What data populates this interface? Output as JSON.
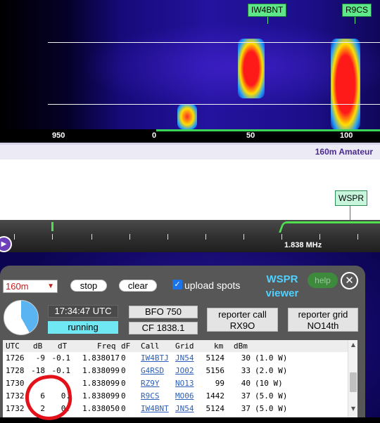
{
  "waterfall": {
    "callouts": [
      "IW4BNT",
      "R9CS"
    ],
    "scale_labels": [
      "950",
      "0",
      "50",
      "100"
    ]
  },
  "band_bar": {
    "label": "160m Amateur"
  },
  "spectrum": {
    "wspr_tag": "WSPR"
  },
  "dial": {
    "frequency_label": "1.838 MHz"
  },
  "panel": {
    "band_select": "160m",
    "stop_label": "stop",
    "clear_label": "clear",
    "upload_checked": true,
    "upload_label": "upload spots",
    "title": "WSPR viewer",
    "help_label": "help",
    "close_symbol": "✕",
    "time_text": "17:34:47 UTC",
    "status_text": "running",
    "progress_fraction": 0.42,
    "bfo_text": "BFO 750",
    "cf_text": "CF 1838.1",
    "reporter_call_label": "reporter call",
    "reporter_call_value": "RX9O",
    "reporter_grid_label": "reporter grid",
    "reporter_grid_value": "NO14th"
  },
  "spots": {
    "headers": [
      "UTC",
      "dB",
      "dT",
      "Freq",
      "dF",
      "Call",
      "Grid",
      "km",
      "dBm"
    ],
    "rows": [
      [
        "1726",
        "-9",
        "-0.1",
        "1.838017",
        "0",
        "IW4BTJ",
        "JN54",
        "5124",
        "30",
        "(1.0 W)"
      ],
      [
        "1728",
        "-18",
        "-0.1",
        "1.838099",
        "0",
        "G4RSD",
        "JO02",
        "5156",
        "33",
        "(2.0 W)"
      ],
      [
        "1730",
        "",
        "",
        "1.838099",
        "0",
        "RZ9Y",
        "NO13",
        "99",
        "40",
        "(10 W)"
      ],
      [
        "1732",
        "6",
        "0.",
        "1.838099",
        "0",
        "R9CS",
        "MO06",
        "1442",
        "37",
        "(5.0 W)"
      ],
      [
        "1732",
        "2",
        "0.",
        "1.838050",
        "0",
        "IW4BNT",
        "JN54",
        "5124",
        "37",
        "(5.0 W)"
      ]
    ]
  },
  "colors": {
    "accent_cyan": "#4fd1ff",
    "running_bg": "#6fe8f4",
    "pie_fill": "#5ab4f2",
    "link": "#2b5fb8",
    "annotation": "#e3121a",
    "green_marker": "#5fe88a"
  }
}
